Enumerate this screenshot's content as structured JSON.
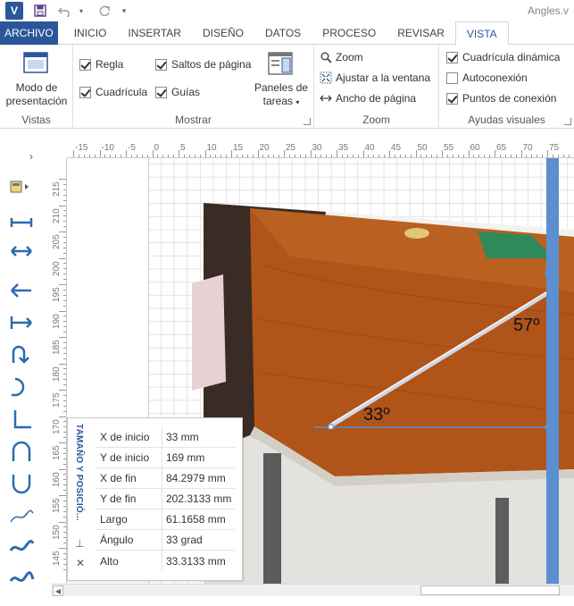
{
  "app": {
    "icon_letter": "V",
    "document_title": "Angles.v"
  },
  "qat": {
    "save_icon": "save-icon",
    "undo_icon": "undo-icon",
    "redo_icon": "redo-icon",
    "customize_icon": "customize-qat-icon"
  },
  "tabs": [
    "ARCHIVO",
    "INICIO",
    "INSERTAR",
    "DISEÑO",
    "DATOS",
    "PROCESO",
    "REVISAR",
    "VISTA"
  ],
  "ribbon": {
    "vistas": {
      "button_line1": "Modo de",
      "button_line2": "presentación",
      "label": "Vistas"
    },
    "mostrar": {
      "regla": "Regla",
      "cuadricula": "Cuadrícula",
      "saltos": "Saltos de página",
      "guias": "Guías",
      "paneles_line1": "Paneles de",
      "paneles_line2": "tareas",
      "label": "Mostrar"
    },
    "zoom": {
      "zoom": "Zoom",
      "ajustar": "Ajustar a la ventana",
      "ancho": "Ancho de página",
      "label": "Zoom"
    },
    "ayudas": {
      "dinamica": "Cuadrícula dinámica",
      "autoconexion": "Autoconexión",
      "puntos": "Puntos de conexión",
      "label": "Ayudas visuales"
    }
  },
  "ruler": {
    "horizontal": [
      "-15",
      "-10",
      "-5",
      "0",
      "5",
      "10",
      "15",
      "20",
      "25",
      "30",
      "35",
      "40",
      "45",
      "50",
      "55",
      "60",
      "65",
      "70",
      "75"
    ],
    "vertical": [
      "215",
      "210",
      "205",
      "200",
      "195",
      "190",
      "185",
      "180",
      "175",
      "170",
      "165",
      "160",
      "155",
      "150",
      "145"
    ]
  },
  "drawing": {
    "angle_left": "33º",
    "angle_right": "57º"
  },
  "size_position": {
    "title": "TAMAÑO Y POSICIÓ...",
    "rows": [
      {
        "label": "X de inicio",
        "value": "33 mm"
      },
      {
        "label": "Y de inicio",
        "value": "169 mm"
      },
      {
        "label": "X de fin",
        "value": "84.2979 mm"
      },
      {
        "label": "Y de fin",
        "value": "202.3133 mm"
      },
      {
        "label": "Largo",
        "value": "61.1658 mm"
      },
      {
        "label": "Ángulo",
        "value": "33 grad"
      },
      {
        "label": "Alto",
        "value": "33.3133 mm"
      }
    ]
  },
  "colors": {
    "accent": "#2b579a",
    "connector": "#5b8fd0"
  }
}
